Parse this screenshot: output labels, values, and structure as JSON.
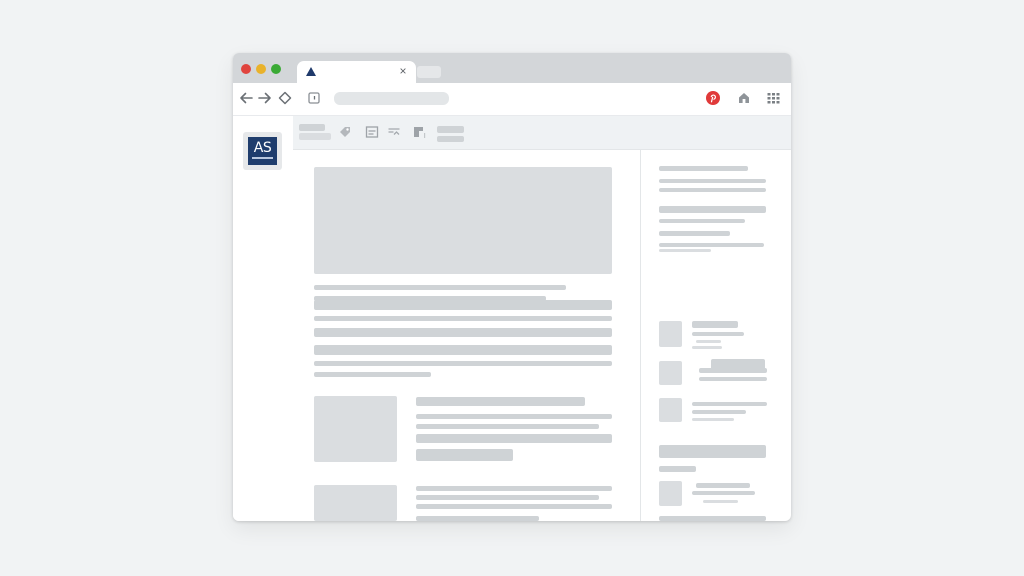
{
  "browser": {
    "traffic_lights": [
      {
        "name": "close",
        "color": "#e0443e"
      },
      {
        "name": "minimize",
        "color": "#e9b22b"
      },
      {
        "name": "maximize",
        "color": "#3aaa35"
      }
    ],
    "active_tab": {
      "favicon": "triangle-icon",
      "close_symbol": "×"
    },
    "toolbar_icons": [
      "back-arrow-icon",
      "forward-arrow-icon",
      "tag-icon",
      "bookmark-icon",
      "pinterest-icon",
      "home-icon",
      "grid-menu-icon"
    ]
  },
  "site": {
    "logo_text": "AS",
    "logo_color": "#1f3d6d"
  },
  "app_toolbar": {
    "icons": [
      "tag-icon",
      "image-icon",
      "link-icon",
      "document-icon"
    ]
  }
}
